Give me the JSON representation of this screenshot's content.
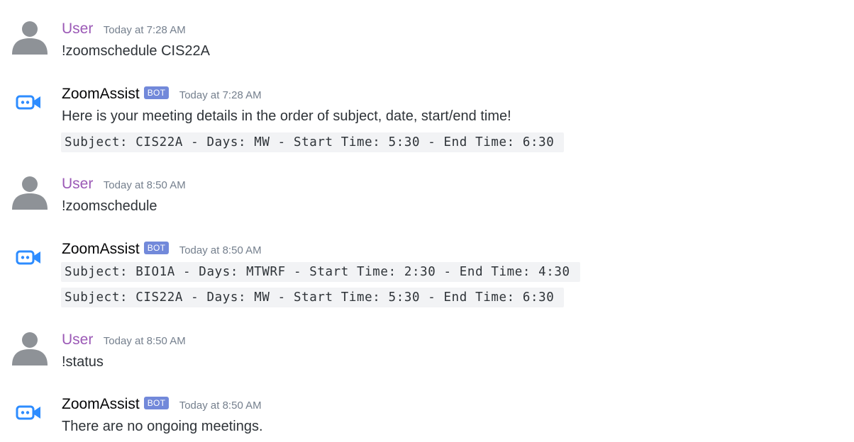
{
  "messages": [
    {
      "author": "User",
      "time": "Today at 7:28 AM",
      "text": "!zoomschedule CIS22A"
    },
    {
      "author": "ZoomAssist",
      "badge": "BOT",
      "time": "Today at 7:28 AM",
      "text": "Here is your meeting details in the order of subject, date, start/end time!",
      "code": [
        "Subject: CIS22A - Days: MW - Start Time: 5:30 - End Time: 6:30"
      ]
    },
    {
      "author": "User",
      "time": "Today at 8:50 AM",
      "text": "!zoomschedule"
    },
    {
      "author": "ZoomAssist",
      "badge": "BOT",
      "time": "Today at 8:50 AM",
      "code": [
        "Subject: BIO1A - Days: MTWRF - Start Time: 2:30 - End Time: 4:30",
        "Subject: CIS22A - Days: MW - Start Time: 5:30 - End Time: 6:30"
      ]
    },
    {
      "author": "User",
      "time": "Today at 8:50 AM",
      "text": "!status"
    },
    {
      "author": "ZoomAssist",
      "badge": "BOT",
      "time": "Today at 8:50 AM",
      "text": "There are no ongoing meetings."
    }
  ],
  "colors": {
    "user_name": "#9b59b6",
    "bot_badge": "#7289da",
    "bot_icon": "#2d8cff",
    "avatar": "#8e9297"
  },
  "icons": {
    "user_avatar": "default-user-avatar-icon",
    "bot_avatar": "zoom-discord-bot-icon"
  }
}
